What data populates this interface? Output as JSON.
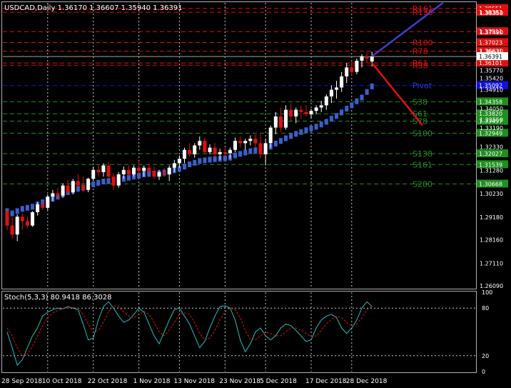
{
  "header": {
    "symbol": "USDCAD",
    "timeframe": "Daily",
    "ohlc": "1.36170 1.36607 1.35940 1.36391"
  },
  "stoch_header": "Stoch(5,3,3) 80.9418 86.3028",
  "colors": {
    "background": "#000000",
    "bull": "#ffffff",
    "bear": "#e01010",
    "ma": "#3a5fcd",
    "resistance": "#e01010",
    "pivot": "#1010e0",
    "support": "#1f8f1f",
    "stoch_main": "#20c0c0",
    "stoch_signal": "#e01010",
    "projection_up": "#3a40d0",
    "projection_down": "#e01010"
  },
  "chart_data": [
    {
      "type": "candlestick",
      "ylim": [
        1.26,
        1.388
      ],
      "x_dates": [
        "28 Sep 2018",
        "10 Oct 2018",
        "22 Oct 2018",
        "1 Nov 2018",
        "13 Nov 2018",
        "23 Nov 2018",
        "5 Dec 2018",
        "17 Dec 2018",
        "28 Dec 2018"
      ],
      "y_ticks": [
        "1.38350",
        "1.37490",
        "1.36630",
        "1.35770",
        "1.35420",
        "1.34910",
        "1.34050",
        "1.33550",
        "1.33190",
        "1.32330",
        "1.31280",
        "1.30230",
        "1.29180",
        "1.28160",
        "1.27110",
        "1.26090"
      ],
      "current_price": "1.36391",
      "levels": [
        {
          "label": "R161",
          "price": 1.3855,
          "price_label": "1.38551",
          "kind": "resistance"
        },
        {
          "label": "R138",
          "price": 1.3838,
          "price_label": "1.38383",
          "kind": "resistance"
        },
        {
          "label": "",
          "price": 1.3751,
          "price_label": "1.37511",
          "kind": "resistance"
        },
        {
          "label": "R100",
          "price": 1.3702,
          "price_label": "1.37023",
          "kind": "resistance"
        },
        {
          "label": "R78",
          "price": 1.3663,
          "price_label": "1.36631",
          "kind": "resistance"
        },
        {
          "label": "R61",
          "price": 1.361,
          "price_label": "1.36101",
          "kind": "resistance"
        },
        {
          "label": "R38",
          "price": 1.36,
          "price_label": "",
          "kind": "resistance"
        },
        {
          "label": "Pivot",
          "price": 1.3509,
          "price_label": "1.35092",
          "kind": "pivot"
        },
        {
          "label": "S38",
          "price": 1.3436,
          "price_label": "1.34358",
          "kind": "support"
        },
        {
          "label": "S61",
          "price": 1.3382,
          "price_label": "1.33820",
          "kind": "support"
        },
        {
          "label": "S78",
          "price": 1.3349,
          "price_label": "1.33457",
          "kind": "support"
        },
        {
          "label": "S100",
          "price": 1.3295,
          "price_label": "1.32949",
          "kind": "support"
        },
        {
          "label": "S138",
          "price": 1.3203,
          "price_label": "1.32027",
          "kind": "support"
        },
        {
          "label": "S161",
          "price": 1.3154,
          "price_label": "1.31539",
          "kind": "support"
        },
        {
          "label": "S200",
          "price": 1.3067,
          "price_label": "1.30668",
          "kind": "support"
        }
      ],
      "candles": [
        [
          1.2945,
          1.295,
          1.286,
          1.288
        ],
        [
          1.288,
          1.292,
          1.282,
          1.284
        ],
        [
          1.284,
          1.293,
          1.281,
          1.292
        ],
        [
          1.292,
          1.2935,
          1.286,
          1.29
        ],
        [
          1.29,
          1.292,
          1.287,
          1.288
        ],
        [
          1.288,
          1.2945,
          1.2875,
          1.294
        ],
        [
          1.294,
          1.2985,
          1.2925,
          1.2975
        ],
        [
          1.2975,
          1.299,
          1.295,
          1.296
        ],
        [
          1.296,
          1.302,
          1.295,
          1.301
        ],
        [
          1.301,
          1.304,
          1.299,
          1.3025
        ],
        [
          1.3025,
          1.305,
          1.3,
          1.3015
        ],
        [
          1.3015,
          1.307,
          1.3005,
          1.306
        ],
        [
          1.306,
          1.3085,
          1.302,
          1.303
        ],
        [
          1.303,
          1.309,
          1.302,
          1.308
        ],
        [
          1.308,
          1.311,
          1.305,
          1.306
        ],
        [
          1.306,
          1.31,
          1.303,
          1.304
        ],
        [
          1.304,
          1.3095,
          1.303,
          1.309
        ],
        [
          1.309,
          1.3145,
          1.308,
          1.313
        ],
        [
          1.313,
          1.3155,
          1.31,
          1.312
        ],
        [
          1.312,
          1.316,
          1.31,
          1.315
        ],
        [
          1.315,
          1.3165,
          1.309,
          1.31
        ],
        [
          1.31,
          1.3115,
          1.304,
          1.306
        ],
        [
          1.306,
          1.312,
          1.305,
          1.311
        ],
        [
          1.311,
          1.3145,
          1.309,
          1.313
        ],
        [
          1.313,
          1.315,
          1.31,
          1.311
        ],
        [
          1.311,
          1.315,
          1.31,
          1.314
        ],
        [
          1.314,
          1.317,
          1.311,
          1.3125
        ],
        [
          1.3125,
          1.315,
          1.31,
          1.314
        ],
        [
          1.314,
          1.316,
          1.3115,
          1.3125
        ],
        [
          1.3125,
          1.3145,
          1.309,
          1.31
        ],
        [
          1.31,
          1.313,
          1.3085,
          1.312
        ],
        [
          1.312,
          1.314,
          1.31,
          1.311
        ],
        [
          1.311,
          1.315,
          1.308,
          1.314
        ],
        [
          1.314,
          1.3175,
          1.312,
          1.316
        ],
        [
          1.316,
          1.3195,
          1.314,
          1.318
        ],
        [
          1.318,
          1.323,
          1.316,
          1.322
        ],
        [
          1.322,
          1.325,
          1.319,
          1.32
        ],
        [
          1.32,
          1.325,
          1.3185,
          1.324
        ],
        [
          1.324,
          1.328,
          1.322,
          1.326
        ],
        [
          1.326,
          1.3275,
          1.32,
          1.321
        ],
        [
          1.321,
          1.3245,
          1.32,
          1.323
        ],
        [
          1.323,
          1.325,
          1.319,
          1.32
        ],
        [
          1.32,
          1.3225,
          1.3175,
          1.321
        ],
        [
          1.321,
          1.323,
          1.319,
          1.3205
        ],
        [
          1.3205,
          1.323,
          1.318,
          1.322
        ],
        [
          1.322,
          1.3275,
          1.321,
          1.326
        ],
        [
          1.326,
          1.328,
          1.323,
          1.325
        ],
        [
          1.325,
          1.327,
          1.322,
          1.326
        ],
        [
          1.326,
          1.3285,
          1.324,
          1.327
        ],
        [
          1.327,
          1.329,
          1.323,
          1.325
        ],
        [
          1.325,
          1.329,
          1.318,
          1.32
        ],
        [
          1.32,
          1.327,
          1.315,
          1.325
        ],
        [
          1.325,
          1.333,
          1.323,
          1.332
        ],
        [
          1.332,
          1.339,
          1.329,
          1.337
        ],
        [
          1.337,
          1.341,
          1.33,
          1.332
        ],
        [
          1.332,
          1.342,
          1.331,
          1.34
        ],
        [
          1.34,
          1.343,
          1.335,
          1.337
        ],
        [
          1.337,
          1.341,
          1.334,
          1.34
        ],
        [
          1.34,
          1.342,
          1.336,
          1.339
        ],
        [
          1.339,
          1.342,
          1.337,
          1.338
        ],
        [
          1.338,
          1.3405,
          1.336,
          1.3395
        ],
        [
          1.3395,
          1.342,
          1.338,
          1.341
        ],
        [
          1.341,
          1.344,
          1.339,
          1.342
        ],
        [
          1.342,
          1.347,
          1.34,
          1.346
        ],
        [
          1.346,
          1.351,
          1.343,
          1.349
        ],
        [
          1.349,
          1.353,
          1.345,
          1.35
        ],
        [
          1.35,
          1.357,
          1.348,
          1.355
        ],
        [
          1.355,
          1.361,
          1.352,
          1.359
        ],
        [
          1.359,
          1.362,
          1.355,
          1.357
        ],
        [
          1.357,
          1.363,
          1.356,
          1.362
        ],
        [
          1.362,
          1.365,
          1.359,
          1.364
        ],
        [
          1.364,
          1.366,
          1.361,
          1.363
        ],
        [
          1.3617,
          1.3661,
          1.3594,
          1.3639
        ]
      ],
      "ma": [
        1.2945,
        1.2935,
        1.2945,
        1.2955,
        1.296,
        1.2965,
        1.2975,
        1.2985,
        1.2995,
        1.3,
        1.301,
        1.302,
        1.303,
        1.3038,
        1.3045,
        1.305,
        1.3058,
        1.3065,
        1.3072,
        1.3078,
        1.308,
        1.3082,
        1.3085,
        1.309,
        1.3095,
        1.31,
        1.3105,
        1.311,
        1.3112,
        1.3113,
        1.3115,
        1.3118,
        1.3122,
        1.3128,
        1.3135,
        1.3145,
        1.3155,
        1.3162,
        1.317,
        1.3173,
        1.3176,
        1.3178,
        1.318,
        1.3182,
        1.3185,
        1.3195,
        1.3202,
        1.3208,
        1.3214,
        1.3218,
        1.3218,
        1.3222,
        1.3234,
        1.3248,
        1.326,
        1.3272,
        1.3282,
        1.3292,
        1.33,
        1.3308,
        1.3316,
        1.3324,
        1.3334,
        1.3346,
        1.336,
        1.3372,
        1.3388,
        1.3405,
        1.342,
        1.3438,
        1.3455,
        1.348,
        1.3505
      ],
      "projection": {
        "up": {
          "from_index": 72,
          "from_price": 1.364,
          "to_index": 86,
          "to_price": 1.388
        },
        "down": {
          "from_index": 72,
          "from_price": 1.361,
          "to_index": 82,
          "to_price": 1.333
        }
      }
    },
    {
      "type": "line",
      "title": "Stoch(5,3,3) 80.9418 86.3028",
      "ylim": [
        0,
        100
      ],
      "y_ticks": [
        "100",
        "80",
        "20",
        "0"
      ],
      "levels": [
        80,
        20
      ],
      "series": [
        {
          "values": [
            50,
            30,
            8,
            15,
            30,
            45,
            55,
            70,
            75,
            78,
            80,
            79,
            82,
            80,
            78,
            60,
            40,
            42,
            65,
            82,
            88,
            80,
            70,
            62,
            65,
            72,
            80,
            75,
            60,
            45,
            35,
            50,
            65,
            78,
            80,
            70,
            60,
            45,
            30,
            38,
            55,
            70,
            82,
            83,
            80,
            65,
            40,
            25,
            35,
            50,
            55,
            45,
            40,
            45,
            55,
            60,
            58,
            52,
            45,
            38,
            40,
            55,
            65,
            70,
            72,
            68,
            55,
            48,
            55,
            65,
            80,
            88,
            82
          ]
        },
        {
          "values": [
            55,
            45,
            30,
            20,
            22,
            32,
            45,
            58,
            68,
            74,
            77,
            79,
            80,
            81,
            80,
            72,
            60,
            50,
            52,
            62,
            75,
            83,
            82,
            75,
            70,
            68,
            72,
            76,
            72,
            62,
            50,
            45,
            52,
            62,
            72,
            74,
            72,
            62,
            48,
            40,
            42,
            52,
            65,
            75,
            80,
            78,
            68,
            52,
            40,
            40,
            45,
            50,
            48,
            45,
            45,
            50,
            55,
            55,
            52,
            48,
            44,
            45,
            52,
            60,
            66,
            70,
            68,
            62,
            58,
            60,
            68,
            78,
            82
          ]
        }
      ]
    }
  ]
}
